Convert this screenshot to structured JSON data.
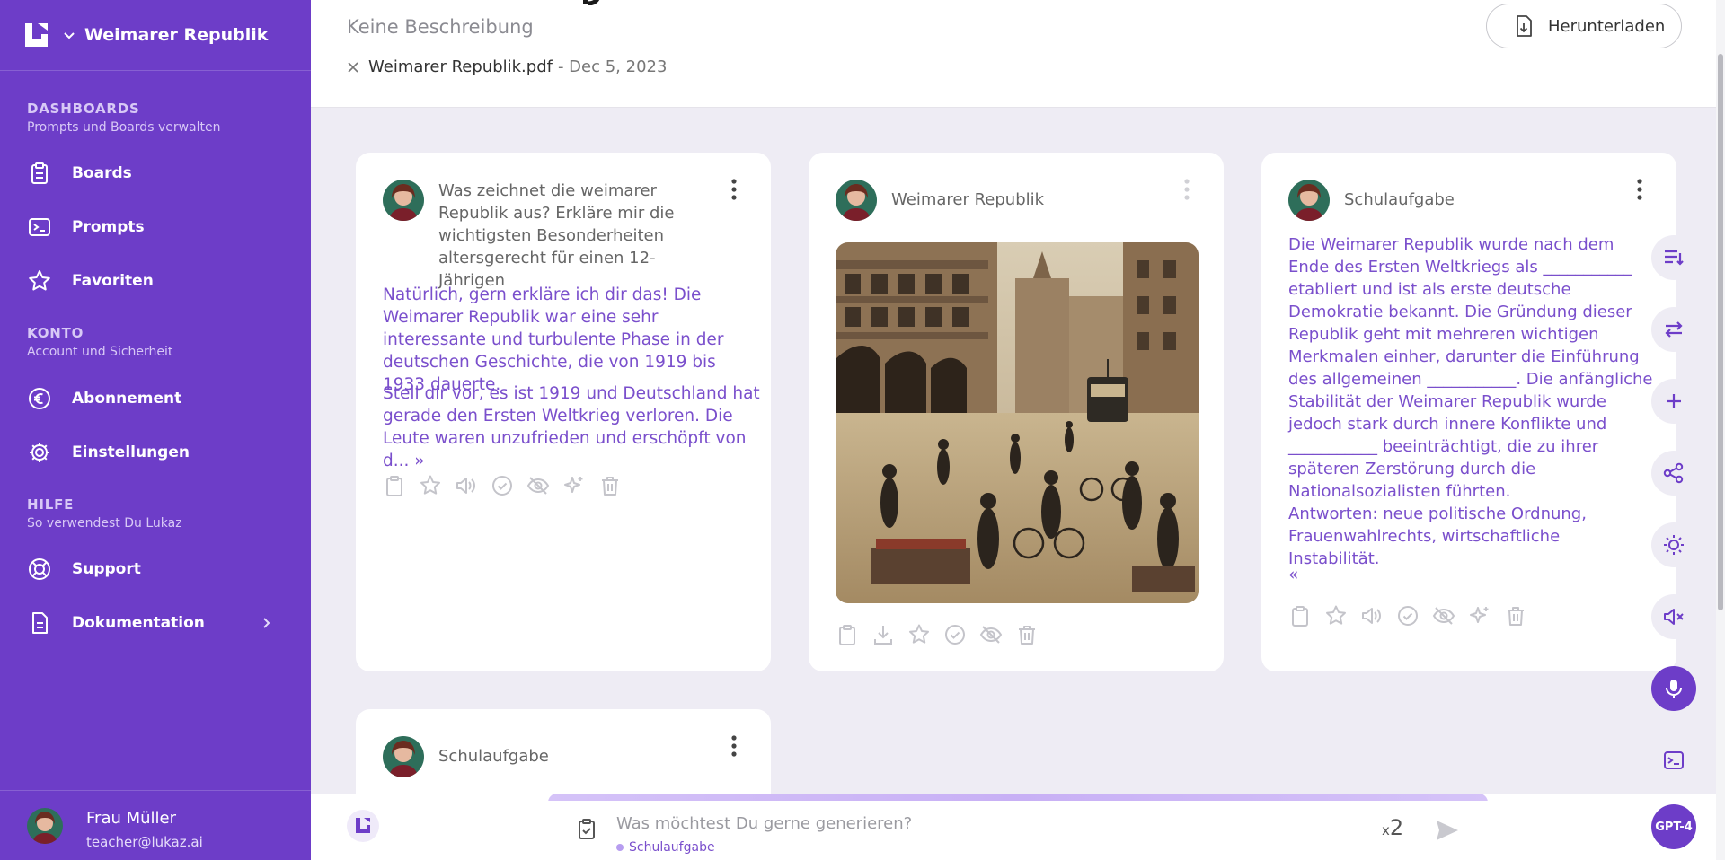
{
  "sidebar": {
    "workspace": "Weimarer Republik",
    "sections": [
      {
        "title": "DASHBOARDS",
        "subtitle": "Prompts und Boards verwalten"
      },
      {
        "title": "KONTO",
        "subtitle": "Account und Sicherheit"
      },
      {
        "title": "HILFE",
        "subtitle": "So verwendest Du Lukaz"
      }
    ],
    "items": [
      {
        "label": "Boards",
        "icon": "clipboard-icon"
      },
      {
        "label": "Prompts",
        "icon": "terminal-icon"
      },
      {
        "label": "Favoriten",
        "icon": "star-icon"
      },
      {
        "label": "Abonnement",
        "icon": "euro-icon"
      },
      {
        "label": "Einstellungen",
        "icon": "gear-icon"
      },
      {
        "label": "Support",
        "icon": "lifebuoy-icon"
      },
      {
        "label": "Dokumentation",
        "icon": "document-icon"
      }
    ],
    "user": {
      "name": "Frau Müller",
      "email": "teacher@lukaz.ai"
    }
  },
  "header": {
    "description": "Keine Beschreibung",
    "file_name": "Weimarer Republik.pdf",
    "file_date": "- Dec 5, 2023",
    "download_label": "Herunterladen"
  },
  "cards": [
    {
      "title": "Was zeichnet die weimarer Republik aus? Erkläre mir die wichtigsten Besonderheiten altersgerecht für einen 12-Jährigen",
      "paragraphs": [
        "Natürlich, gern erkläre ich dir das! Die Weimarer Republik war eine sehr interessante und turbulente Phase in der deutschen Geschichte, die von 1919 bis 1933 dauerte.",
        "Stell dir vor, es ist 1919 und Deutschland hat gerade den Ersten Weltkrieg verloren. Die Leute waren unzufrieden und erschöpft von d..."
      ],
      "expand": "»"
    },
    {
      "title": "Weimarer Republik"
    },
    {
      "title": "Schulaufgabe",
      "text": "Die Weimarer Republik wurde nach dem Ende des Ersten Weltkriegs als ___________ etabliert und ist als erste deutsche Demokratie bekannt. Die Gründung dieser Republik geht mit mehreren wichtigen Merkmalen einher, darunter die Einführung des allgemeinen ___________. Die anfängliche Stabilität der Weimarer Republik wurde jedoch stark durch innere Konflikte und ___________ beeinträchtigt, die zu ihrer späteren Zerstörung durch die Nationalsozialisten führten.",
      "answers": "Antworten: neue politische Ordnung, Frauenwahlrechts, wirtschaftliche Instabilität.",
      "collapse": "«"
    },
    {
      "title": "Schulaufgabe"
    }
  ],
  "composer": {
    "placeholder": "Was möchtest Du gerne generieren?",
    "context": "Schulaufgabe",
    "multiplier_x": "x",
    "multiplier": "2",
    "model": "GPT-4"
  },
  "colors": {
    "accent": "#6d3dc8",
    "text_purple": "#7a4fcc",
    "background": "#eeecf4"
  }
}
